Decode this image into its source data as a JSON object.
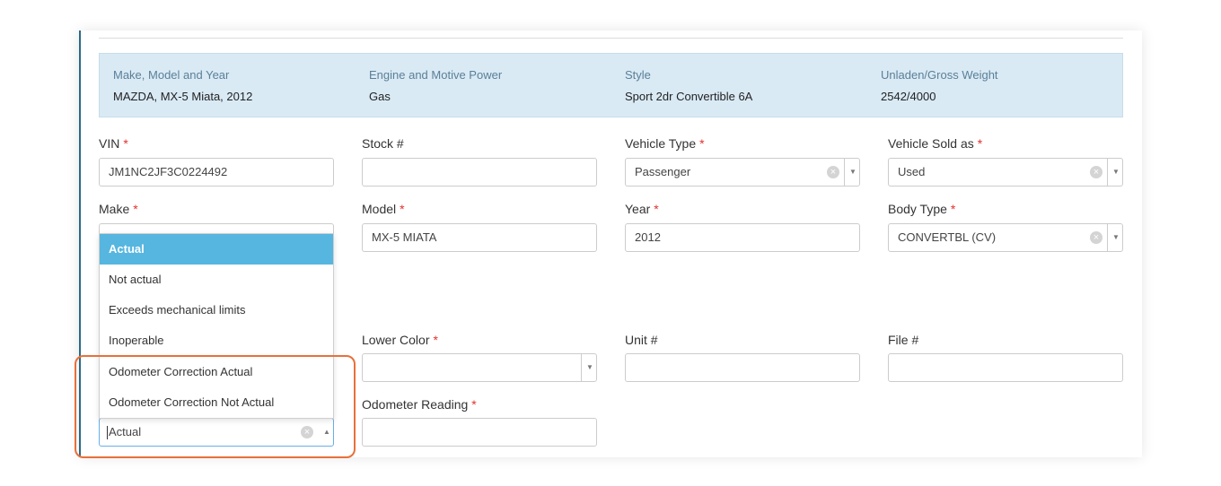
{
  "summary": {
    "make_model_year_label": "Make, Model and Year",
    "make_model_year_value": "MAZDA, MX-5 Miata, 2012",
    "engine_label": "Engine and Motive Power",
    "engine_value": "Gas",
    "style_label": "Style",
    "style_value": "Sport 2dr Convertible 6A",
    "weight_label": "Unladen/Gross Weight",
    "weight_value": "2542/4000"
  },
  "required_mark": "*",
  "fields": {
    "vin": {
      "label": "VIN",
      "value": "JM1NC2JF3C0224492"
    },
    "stock": {
      "label": "Stock #",
      "value": ""
    },
    "vehicle_type": {
      "label": "Vehicle Type",
      "value": "Passenger"
    },
    "vehicle_sold_as": {
      "label": "Vehicle Sold as",
      "value": "Used"
    },
    "make": {
      "label": "Make"
    },
    "model": {
      "label": "Model",
      "value": "MX-5 MIATA"
    },
    "year": {
      "label": "Year",
      "value": "2012"
    },
    "body_type": {
      "label": "Body Type",
      "value": "CONVERTBL (CV)"
    },
    "lower_color": {
      "label": "Lower Color",
      "value": ""
    },
    "unit": {
      "label": "Unit #",
      "value": ""
    },
    "file": {
      "label": "File #",
      "value": ""
    },
    "odometer_reading": {
      "label": "Odometer Reading",
      "value": ""
    },
    "odometer_status": {
      "value": "Actual"
    }
  },
  "dropdown": {
    "options": [
      "Actual",
      "Not actual",
      "Exceeds mechanical limits",
      "Inoperable",
      "Odometer Correction Actual",
      "Odometer Correction Not Actual"
    ],
    "selected_index": 0
  },
  "icons": {
    "clear": "×",
    "arrow_down": "▼",
    "arrow_up": "▲"
  },
  "colors": {
    "accent": "#56b6e0",
    "required": "#e0322e",
    "highlight": "#e8703a",
    "summary_bg": "#d9eaf5"
  }
}
